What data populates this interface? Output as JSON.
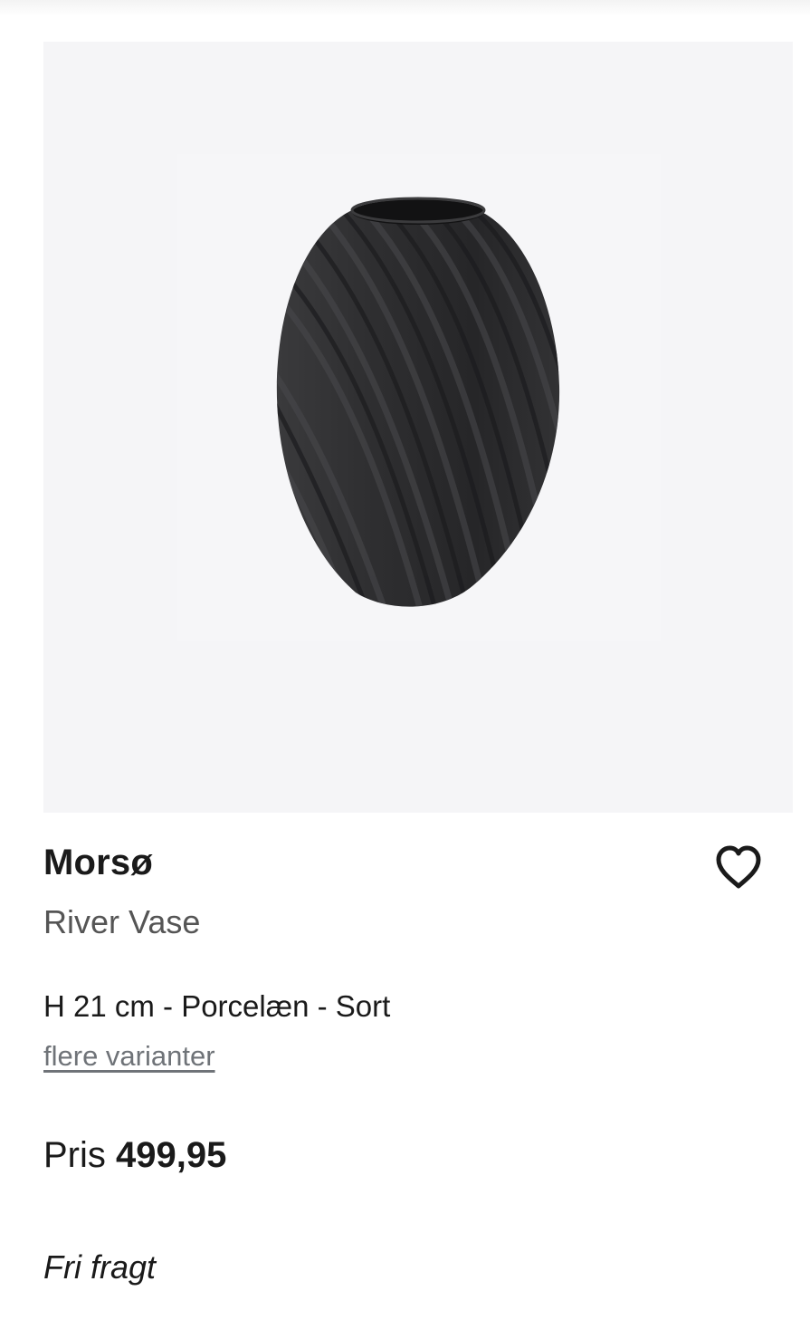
{
  "product": {
    "image_alt": "River Vase",
    "brand": "Morsø",
    "name": "River Vase",
    "variant": "H 21 cm - Porcelæn - Sort",
    "more_variants_label": "flere varianter",
    "price_label": "Pris",
    "price_value": "499,95",
    "shipping_note": "Fri fragt",
    "wishlist_icon": "heart-outline-icon"
  },
  "colors": {
    "image_background": "#f5f5f7",
    "vase": "#2b2b2d",
    "link": "#6f7378"
  }
}
